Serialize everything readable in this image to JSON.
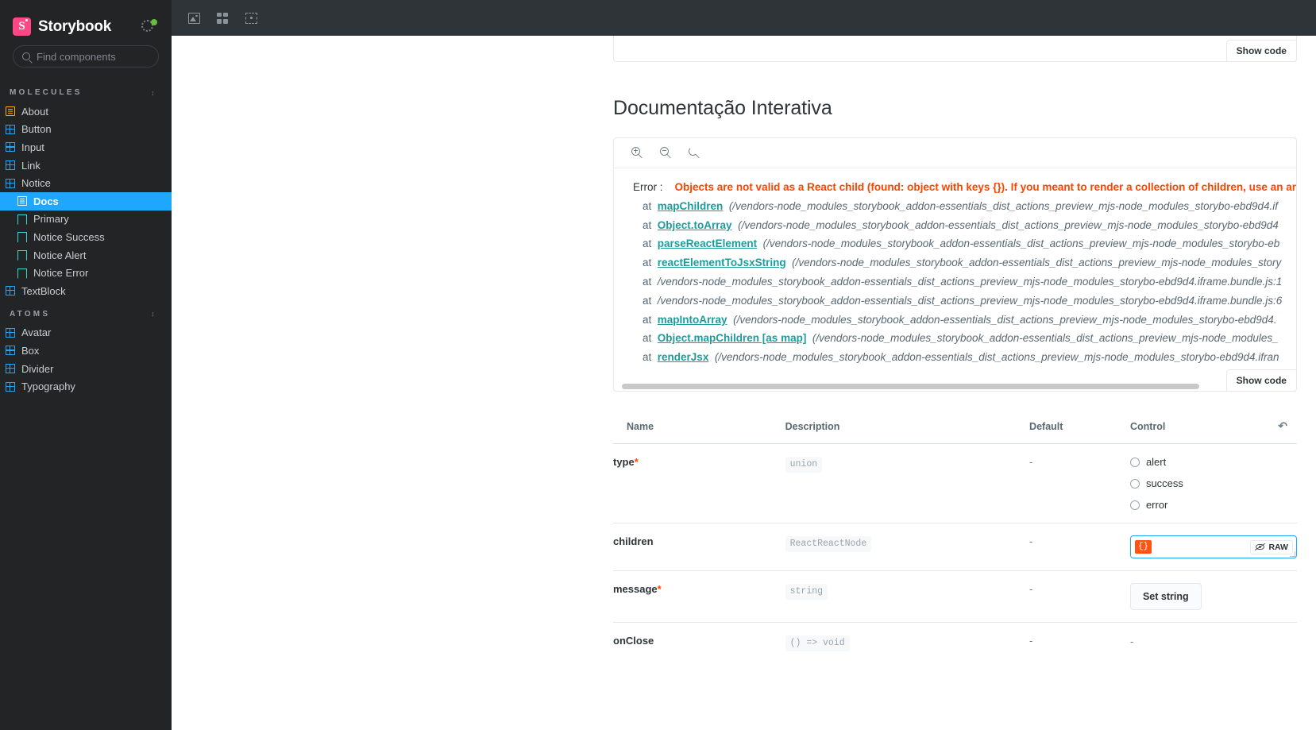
{
  "sidebar": {
    "brand": {
      "logo_letter": "S",
      "title": "Storybook"
    },
    "status_icon": "gear-icon",
    "search": {
      "placeholder": "Find components",
      "value": "",
      "shortcut": "/"
    },
    "groups": [
      {
        "label": "MOLECULES",
        "items": [
          {
            "label": "About",
            "icon": "docs-page-icon",
            "type": "docs",
            "indent": false,
            "active": false
          },
          {
            "label": "Button",
            "icon": "component-icon",
            "type": "component",
            "indent": false,
            "active": false
          },
          {
            "label": "Input",
            "icon": "component-icon",
            "type": "component",
            "indent": false,
            "active": false
          },
          {
            "label": "Link",
            "icon": "component-icon",
            "type": "component",
            "indent": false,
            "active": false
          },
          {
            "label": "Notice",
            "icon": "component-icon",
            "type": "component",
            "indent": false,
            "active": false
          },
          {
            "label": "Docs",
            "icon": "docs-page-icon",
            "type": "docs",
            "indent": true,
            "active": true
          },
          {
            "label": "Primary",
            "icon": "story-icon",
            "type": "story",
            "indent": true,
            "active": false
          },
          {
            "label": "Notice Success",
            "icon": "story-icon",
            "type": "story",
            "indent": true,
            "active": false
          },
          {
            "label": "Notice Alert",
            "icon": "story-icon",
            "type": "story",
            "indent": true,
            "active": false
          },
          {
            "label": "Notice Error",
            "icon": "story-icon",
            "type": "story",
            "indent": true,
            "active": false
          },
          {
            "label": "TextBlock",
            "icon": "component-icon",
            "type": "component",
            "indent": false,
            "active": false
          }
        ]
      },
      {
        "label": "ATOMS",
        "items": [
          {
            "label": "Avatar",
            "icon": "component-icon",
            "type": "component",
            "indent": false,
            "active": false
          },
          {
            "label": "Box",
            "icon": "component-icon",
            "type": "component",
            "indent": false,
            "active": false
          },
          {
            "label": "Divider",
            "icon": "component-icon",
            "type": "component",
            "indent": false,
            "active": false
          },
          {
            "label": "Typography",
            "icon": "component-icon",
            "type": "component",
            "indent": false,
            "active": false
          }
        ]
      }
    ]
  },
  "topbar": {
    "buttons": [
      {
        "name": "go-full-screen",
        "icon": "photo-icon"
      },
      {
        "name": "change-background",
        "icon": "grid-icon"
      },
      {
        "name": "measure-outline",
        "icon": "crop-icon"
      }
    ]
  },
  "docs": {
    "top_block": {
      "show_code_label": "Show code"
    },
    "heading": "Documentação Interativa",
    "preview_toolbar": [
      {
        "name": "zoom-in-button",
        "icon": "zoom-in-icon"
      },
      {
        "name": "zoom-out-button",
        "icon": "zoom-out-icon"
      },
      {
        "name": "zoom-reset-button",
        "icon": "zoom-reset-icon"
      }
    ],
    "show_code_label": "Show code",
    "error": {
      "label": "Error :",
      "message": "Objects are not valid as a React child (found: object with keys {}). If you meant to render a collection of children, use an ar",
      "stack": [
        {
          "at": "at",
          "fn": "mapChildren",
          "path": "(/vendors-node_modules_storybook_addon-essentials_dist_actions_preview_mjs-node_modules_storybo-ebd9d4.if"
        },
        {
          "at": "at",
          "fn": "Object.toArray",
          "path": "(/vendors-node_modules_storybook_addon-essentials_dist_actions_preview_mjs-node_modules_storybo-ebd9d4"
        },
        {
          "at": "at",
          "fn": "parseReactElement",
          "path": "(/vendors-node_modules_storybook_addon-essentials_dist_actions_preview_mjs-node_modules_storybo-eb"
        },
        {
          "at": "at",
          "fn": "reactElementToJsxString",
          "path": "(/vendors-node_modules_storybook_addon-essentials_dist_actions_preview_mjs-node_modules_story"
        },
        {
          "at": "at",
          "fn": "",
          "path": "/vendors-node_modules_storybook_addon-essentials_dist_actions_preview_mjs-node_modules_storybo-ebd9d4.iframe.bundle.js:1"
        },
        {
          "at": "at",
          "fn": "",
          "path": "/vendors-node_modules_storybook_addon-essentials_dist_actions_preview_mjs-node_modules_storybo-ebd9d4.iframe.bundle.js:6"
        },
        {
          "at": "at",
          "fn": "mapIntoArray",
          "path": "(/vendors-node_modules_storybook_addon-essentials_dist_actions_preview_mjs-node_modules_storybo-ebd9d4."
        },
        {
          "at": "at",
          "fn": "Object.mapChildren [as map]",
          "path": "(/vendors-node_modules_storybook_addon-essentials_dist_actions_preview_mjs-node_modules_"
        },
        {
          "at": "at",
          "fn": "renderJsx",
          "path": "(/vendors-node_modules_storybook_addon-essentials_dist_actions_preview_mjs-node_modules_storybo-ebd9d4.ifran"
        }
      ]
    }
  },
  "controls": {
    "headers": {
      "name": "Name",
      "description": "Description",
      "default": "Default",
      "control": "Control",
      "reset_icon": "reset-controls-icon"
    },
    "rows": [
      {
        "name": "type",
        "required": true,
        "type_chip": "union",
        "default": "-",
        "control_kind": "radio",
        "options": [
          "alert",
          "success",
          "error"
        ],
        "selected": ""
      },
      {
        "name": "children",
        "required": false,
        "type_chip": "ReactReactNode",
        "default": "-",
        "control_kind": "object",
        "value_badge": "{}",
        "raw_label": "RAW"
      },
      {
        "name": "message",
        "required": true,
        "type_chip": "string",
        "default": "-",
        "control_kind": "button",
        "button_label": "Set string"
      },
      {
        "name": "onClose",
        "required": false,
        "type_chip": "() => void",
        "default": "-",
        "control_kind": "none",
        "value": "-"
      }
    ]
  },
  "colors": {
    "brand_pink": "#ff4785",
    "accent_blue": "#1ea7fd",
    "error_red": "#ff4400",
    "fn_teal": "#1d9c9c",
    "sidebar_bg": "#222425",
    "topbar_bg": "#2e3438",
    "status_green": "#66bf3c",
    "docs_yellow": "#ffae00",
    "story_teal": "#37d5d3"
  }
}
